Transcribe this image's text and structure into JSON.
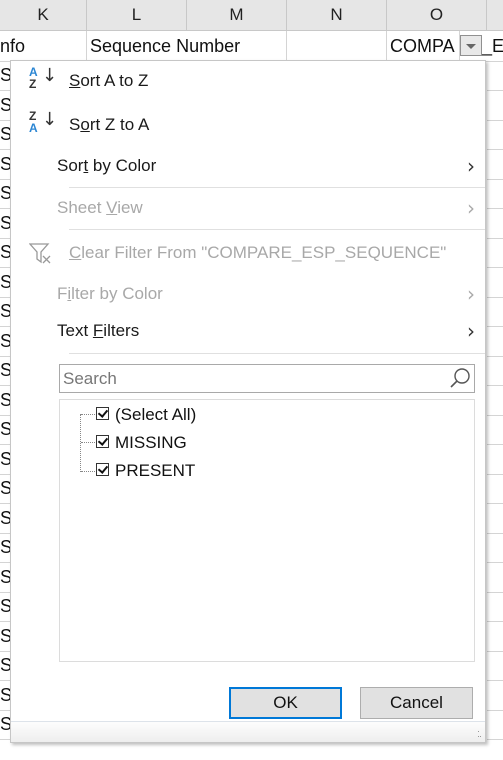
{
  "columns": [
    "K",
    "L",
    "M",
    "N",
    "O"
  ],
  "header_row": {
    "K": "nfo",
    "L": "Sequence Number",
    "M": "",
    "N": "",
    "O": "COMPA",
    "O_overflow": "_E"
  },
  "left_column_fragment": "S",
  "bottom_row_fragment": "",
  "filter_menu": {
    "sort_a_z": {
      "label_u": "S",
      "label_rest": "ort A to Z"
    },
    "sort_z_a": {
      "label_pre": "S",
      "label_u": "o",
      "label_rest": "rt Z to A"
    },
    "sort_by_color": {
      "label_pre": "Sor",
      "label_u": "t",
      "label_rest": " by Color"
    },
    "sheet_view": {
      "label_pre": "Sheet ",
      "label_u": "V",
      "label_rest": "iew",
      "disabled": true
    },
    "clear_filter": {
      "label_u": "C",
      "label_rest": "lear Filter From \"COMPARE_ESP_SEQUENCE\"",
      "disabled": true
    },
    "filter_by_color": {
      "label_pre": "F",
      "label_u": "i",
      "label_rest": "lter by Color",
      "disabled": true
    },
    "text_filters": {
      "label_pre": "Text ",
      "label_u": "F",
      "label_rest": "ilters"
    },
    "submenu_arrow": "›",
    "search": {
      "placeholder": "Search"
    },
    "values": [
      {
        "label": "(Select All)",
        "checked": true
      },
      {
        "label": "MISSING",
        "checked": true
      },
      {
        "label": "PRESENT",
        "checked": true
      }
    ],
    "ok_label": "OK",
    "cancel_label": "Cancel"
  },
  "colors": {
    "accent": "#0078d7",
    "sort_icon_blue": "#2b86d3",
    "disabled_text": "#a8a8a8"
  }
}
